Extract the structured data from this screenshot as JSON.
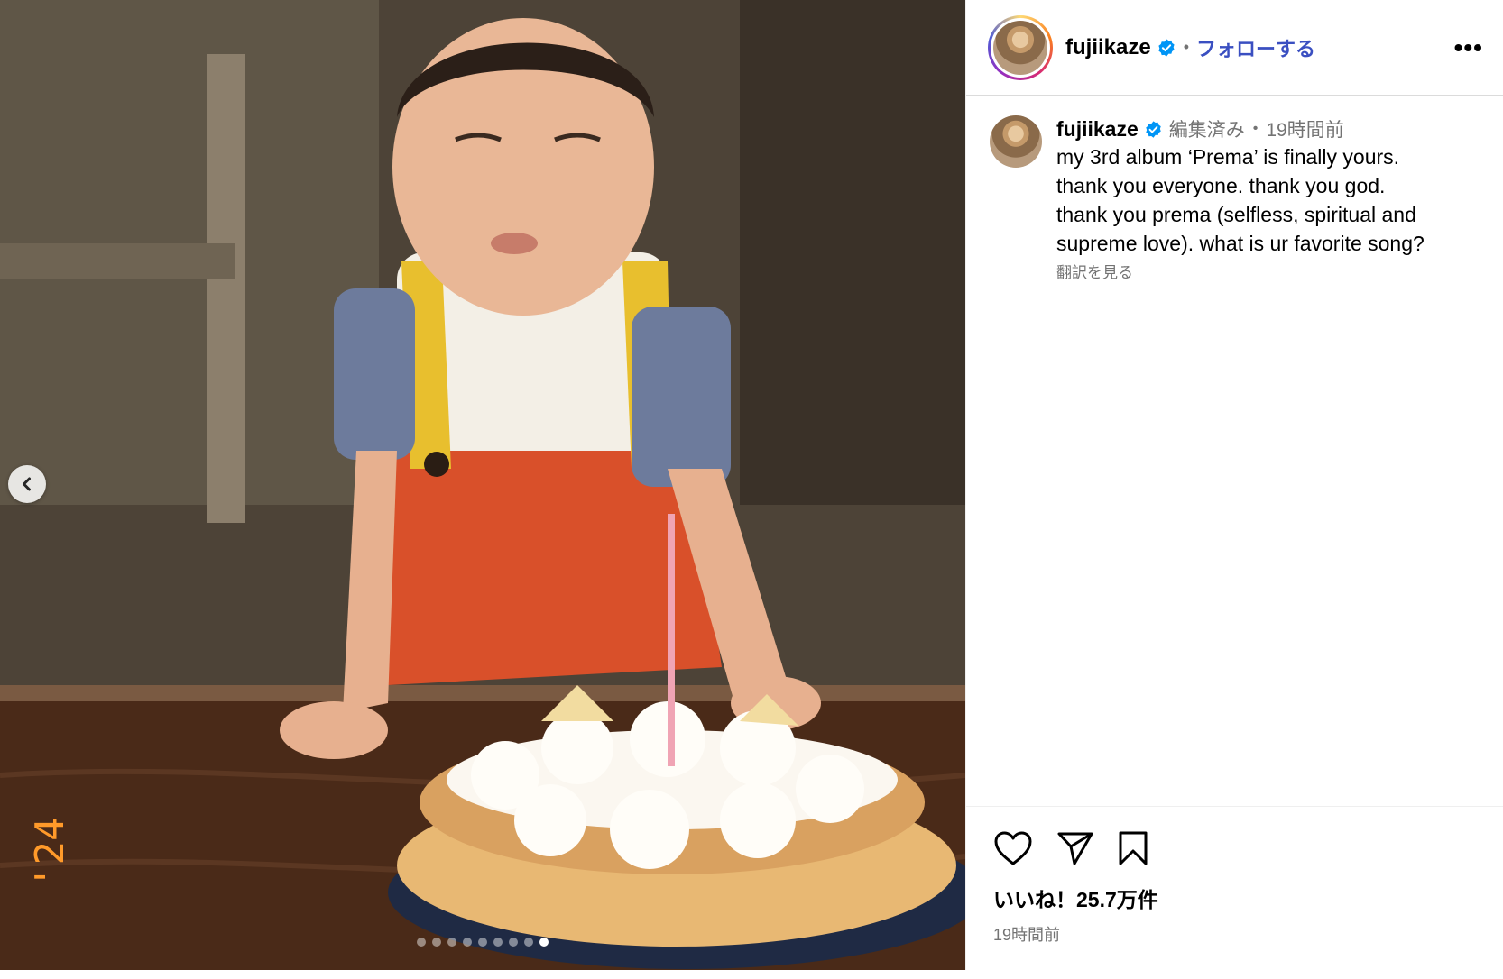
{
  "post": {
    "username": "fujiikaze",
    "follow_label": "フォローする",
    "separator": "•",
    "more_label": "•••"
  },
  "caption": {
    "username": "fujiikaze",
    "edited_label": "編集済み",
    "separator": "•",
    "time_ago": "19時間前",
    "text": "my 3rd album ‘Prema’ is finally yours.\nthank you everyone. thank you god.\nthank you prema (selfless, spiritual and\nsupreme love). what is ur favorite song?",
    "translate_label": "翻訳を見る"
  },
  "footer": {
    "likes": "いいね！25.7万件",
    "time": "19時間前"
  },
  "carousel": {
    "slide_count": 9,
    "active_index": 8
  },
  "icons": {
    "prev": "chevron-left-icon",
    "like": "heart-icon",
    "share": "send-icon",
    "save": "bookmark-icon",
    "verified": "verified-badge-icon"
  },
  "colors": {
    "accent_link": "#3a4fc1",
    "verified_blue": "#0095f6",
    "secondary_text": "#737373"
  }
}
